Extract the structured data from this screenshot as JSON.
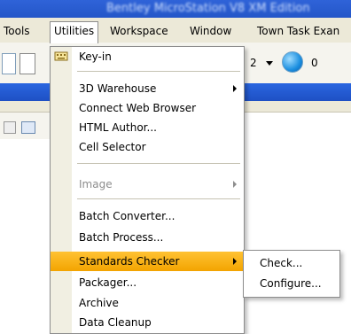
{
  "titlebar": {
    "text": "Bentley MicroStation V8 XM Edition"
  },
  "menubar": {
    "items": [
      {
        "label": "Tools"
      },
      {
        "label": "Utilities"
      },
      {
        "label": "Workspace"
      },
      {
        "label": "Window"
      },
      {
        "label": "Town Task Exan"
      }
    ]
  },
  "toolbar": {
    "level_value": "2",
    "count_value": "0"
  },
  "utilities_menu": {
    "keyin": "Key-in",
    "warehouse": "3D Warehouse",
    "connect_browser": "Connect Web Browser",
    "html_author": "HTML Author...",
    "cell_selector": "Cell Selector",
    "image": "Image",
    "batch_converter": "Batch Converter...",
    "batch_process": "Batch Process...",
    "standards_checker": "Standards Checker",
    "packager": "Packager...",
    "archive": "Archive",
    "data_cleanup": "Data Cleanup"
  },
  "standards_submenu": {
    "check": "Check...",
    "configure": "Configure..."
  },
  "colors": {
    "highlight": "#ffc233",
    "menu_bg": "#ffffff",
    "icon_col": "#f1efe2"
  }
}
